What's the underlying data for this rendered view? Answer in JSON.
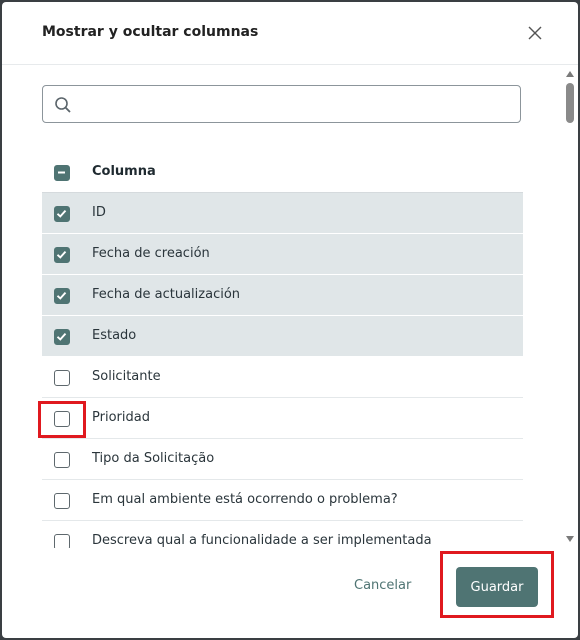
{
  "dialog": {
    "title": "Mostrar y ocultar columnas",
    "search": {
      "value": "",
      "placeholder": ""
    },
    "header_label": "Columna",
    "columns": [
      {
        "label": "ID",
        "checked": true
      },
      {
        "label": "Fecha de creación",
        "checked": true
      },
      {
        "label": "Fecha de actualización",
        "checked": true
      },
      {
        "label": "Estado",
        "checked": true
      },
      {
        "label": "Solicitante",
        "checked": false
      },
      {
        "label": "Prioridad",
        "checked": false
      },
      {
        "label": "Tipo da Solicitação",
        "checked": false
      },
      {
        "label": "Em qual ambiente está ocorrendo o problema?",
        "checked": false
      },
      {
        "label": "Descreva qual a funcionalidade a ser implementada",
        "checked": false
      }
    ],
    "cancel_label": "Cancelar",
    "save_label": "Guardar"
  },
  "colors": {
    "accent": "#4f7473",
    "checked_row_bg": "#e0e6e8",
    "highlight": "#e0191f"
  }
}
